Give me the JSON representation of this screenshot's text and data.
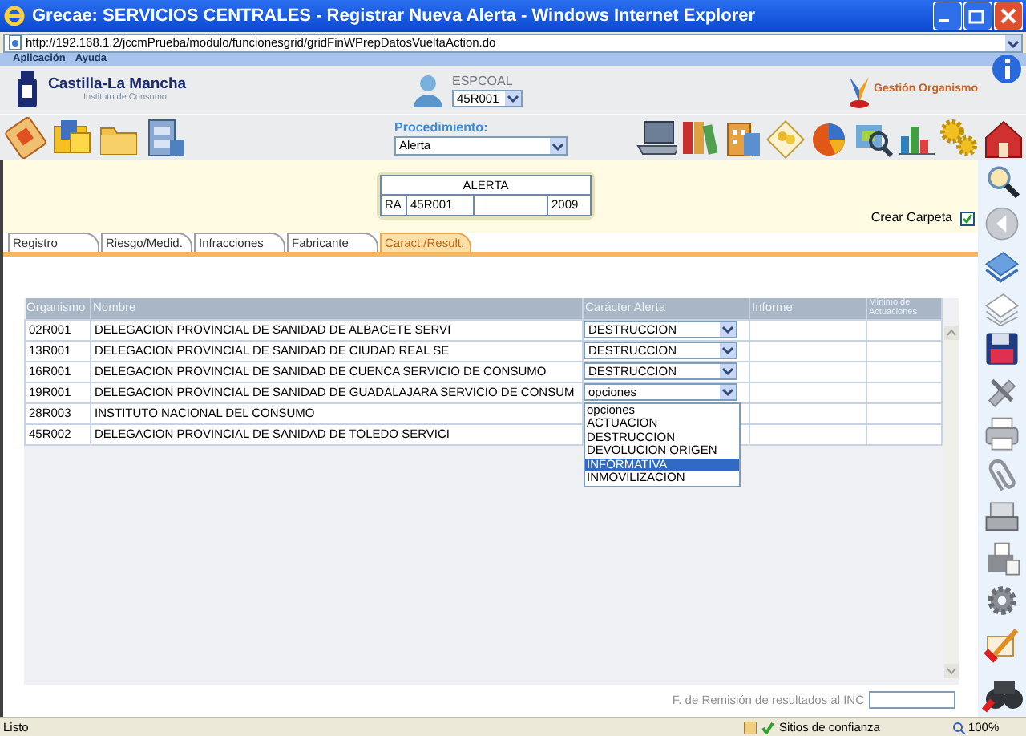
{
  "window": {
    "title": "Grecae: SERVICIOS CENTRALES - Registrar Nueva Alerta - Windows Internet Explorer"
  },
  "address_bar": {
    "url": "http://192.168.1.2/jccmPrueba/modulo/funcionesgrid/gridFinWPrepDatosVueltaAction.do"
  },
  "menu": [
    "Aplicación",
    "Ayuda"
  ],
  "brand": {
    "name": "Castilla-La Mancha",
    "subtitle": "Instituto de Consumo"
  },
  "user": {
    "name": "ESPCOAL",
    "office": "45R001"
  },
  "organization_link": "Gestión Organismo",
  "procedimiento": {
    "label": "Procedimiento:",
    "value": "Alerta"
  },
  "alerta": {
    "title": "ALERTA",
    "prefix": "RA",
    "office": "45R001",
    "year": "2009"
  },
  "crear_carpeta": {
    "label": "Crear Carpeta",
    "checked": true
  },
  "tabs": [
    {
      "label": "Registro",
      "selected": false
    },
    {
      "label": "Riesgo/Medid.",
      "selected": false
    },
    {
      "label": "Infracciones",
      "selected": false
    },
    {
      "label": "Fabricante",
      "selected": false
    },
    {
      "label": "Caract./Result.",
      "selected": true
    }
  ],
  "table": {
    "columns": [
      "Organismo",
      "Nombre",
      "Carácter Alerta",
      "Informe",
      "Mínimo de Actuaciones"
    ],
    "rows": [
      {
        "organismo": "02R001",
        "nombre": "DELEGACION PROVINCIAL DE SANIDAD DE ALBACETE SERVI",
        "caracter": "DESTRUCCION"
      },
      {
        "organismo": "13R001",
        "nombre": "DELEGACION PROVINCIAL DE SANIDAD DE CIUDAD REAL SE",
        "caracter": "DESTRUCCION"
      },
      {
        "organismo": "16R001",
        "nombre": "DELEGACION PROVINCIAL DE SANIDAD DE CUENCA SERVICIO DE CONSUMO",
        "caracter": "DESTRUCCION"
      },
      {
        "organismo": "19R001",
        "nombre": "DELEGACION PROVINCIAL DE SANIDAD DE GUADALAJARA SERVICIO DE CONSUM",
        "caracter": "opciones",
        "options": [
          {
            "label": "opciones",
            "selected": false
          },
          {
            "label": "ACTUACION",
            "selected": false
          },
          {
            "label": "DESTRUCCION",
            "selected": false
          },
          {
            "label": "DEVOLUCION ORIGEN",
            "selected": false
          },
          {
            "label": "INFORMATIVA",
            "selected": true
          },
          {
            "label": "INMOVILIZACION",
            "selected": false
          }
        ]
      },
      {
        "organismo": "28R003",
        "nombre": "INSTITUTO NACIONAL DEL CONSUMO"
      },
      {
        "organismo": "45R002",
        "nombre": "DELEGACION PROVINCIAL DE SANIDAD DE TOLEDO SERVICI"
      }
    ]
  },
  "remision": {
    "label": "F. de Remisión de resultados al INC"
  },
  "status_bar": {
    "text": "Listo",
    "zone": "Sitios de confianza",
    "zoom": "100%"
  }
}
